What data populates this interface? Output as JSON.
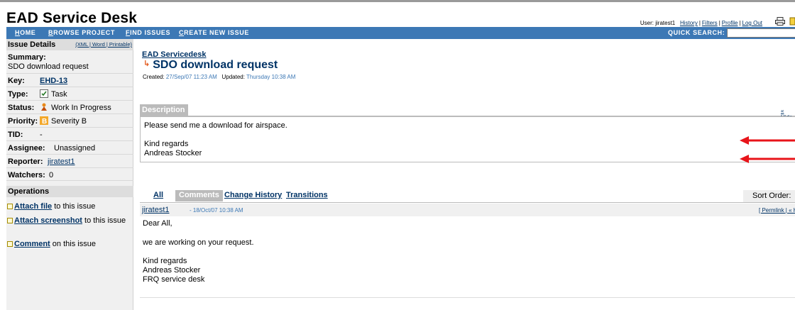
{
  "header": {
    "app_title": "EAD Service Desk",
    "user_prefix": "User: jiratest1",
    "links": [
      "History",
      "Filters",
      "Profile",
      "Log Out"
    ],
    "nav": [
      "HOME",
      "BROWSE PROJECT",
      "FIND ISSUES",
      "CREATE NEW ISSUE"
    ],
    "nav_underline": [
      "H",
      "B",
      "F",
      "C"
    ],
    "nav_rest": [
      "OME",
      "ROWSE PROJECT",
      "IND ISSUES",
      "REATE NEW ISSUE"
    ],
    "quick_search_label": "QUICK SEARCH:",
    "quick_search_value": ""
  },
  "left": {
    "details_title": "Issue Details",
    "details_links": "(XML | Word | Printable)",
    "summary_label": "Summary:",
    "summary_value": "SDO download request",
    "fields": [
      {
        "label": "Key:",
        "value": "EHD-13"
      },
      {
        "label": "Type:",
        "value": "Task",
        "icon": "task-icon"
      },
      {
        "label": "Status:",
        "value": "Work In Progress",
        "icon": "work-in-progress-icon"
      },
      {
        "label": "Priority:",
        "value": "Severity B",
        "icon": "severity-b-icon"
      },
      {
        "label": "TID:",
        "value": "-"
      },
      {
        "label": "Assignee:",
        "value": "Unassigned"
      },
      {
        "label": "Reporter:",
        "value": "jiratest1"
      },
      {
        "label": "Watchers:",
        "value": "0"
      }
    ],
    "operations_title": "Operations",
    "operations": [
      {
        "link": "Attach file",
        "text": " to this issue"
      },
      {
        "link": "Attach screenshot",
        "text": " to this issue"
      },
      {
        "link": "Comment",
        "text": " on this issue"
      }
    ]
  },
  "issue": {
    "project": "EAD Servicedesk",
    "title": "SDO download request",
    "created_label": "Created:",
    "created": "27/Sep/07 11:23 AM",
    "updated_label": "Updated:",
    "updated": "Thursday 10:38 AM"
  },
  "description": {
    "tab": "Description",
    "hide": "« Hide",
    "lines": [
      "Please send me a download for airspace.",
      "Kind regards",
      "Andreas Stocker"
    ]
  },
  "activity": {
    "tabs": [
      "All",
      "Comments",
      "Change History",
      "Transitions"
    ],
    "sort_label": "Sort Order:"
  },
  "comment": {
    "author": "jiratest1",
    "date": "- 18/Oct/07 10:38 AM",
    "actions": "[ Permlink | « Hide ]",
    "lines": [
      "Dear All,",
      "we are working on your request.",
      "Kind regards",
      "Andreas Stocker",
      "FRQ service desk"
    ]
  },
  "colors": {
    "nav_bg": "#3c78b5",
    "link": "#003366",
    "arrow": "#e8141a"
  }
}
